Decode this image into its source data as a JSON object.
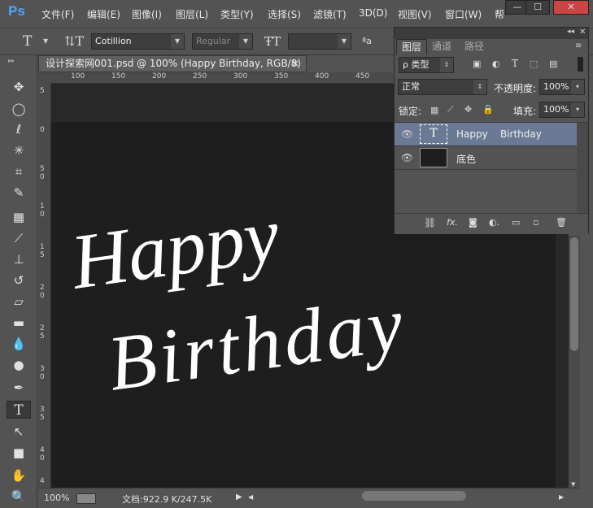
{
  "app": {
    "logo": "Ps"
  },
  "menu": [
    "文件(F)",
    "编辑(E)",
    "图像(I)",
    "图层(L)",
    "类型(Y)",
    "选择(S)",
    "滤镜(T)",
    "3D(D)",
    "视图(V)",
    "窗口(W)",
    "帮"
  ],
  "window_controls": {
    "minimize": "—",
    "maximize": "☐",
    "close": "✕"
  },
  "options": {
    "font_family": "Cotillion",
    "font_style": "Regular",
    "font_size": "",
    "aa_label": "ªa"
  },
  "document": {
    "tab_title": "设计探索网001.psd @ 100% (Happy    Birthday, RGB/8)",
    "tab_close": "×",
    "canvas_text_line1": "Happy",
    "canvas_text_line2": "Birthday"
  },
  "rulers": {
    "horizontal": [
      "100",
      "150",
      "200",
      "250",
      "300",
      "350",
      "400",
      "450"
    ],
    "vertical": [
      "5",
      "0",
      "5",
      "0",
      "1",
      "0",
      "1",
      "5",
      "2",
      "0",
      "2",
      "5",
      "3",
      "0",
      "3",
      "5",
      "4",
      "0",
      "4",
      "5"
    ]
  },
  "status": {
    "zoom": "100%",
    "doc_info": "文档:922.9 K/247.5K"
  },
  "layers_panel": {
    "tabs": [
      "图层",
      "通道",
      "路径"
    ],
    "filter_label": "ρ 类型",
    "blend_mode": "正常",
    "opacity_label": "不透明度:",
    "opacity_value": "100%",
    "lock_label": "锁定:",
    "fill_label": "填充:",
    "fill_value": "100%",
    "layers": [
      {
        "name": "Happy    Birthday",
        "type": "text",
        "selected": true
      },
      {
        "name": "底色",
        "type": "fill",
        "selected": false
      }
    ],
    "footer_icons": [
      "link-icon",
      "fx-icon",
      "mask-icon",
      "adjustment-icon",
      "group-icon",
      "new-layer-icon",
      "trash-icon"
    ]
  },
  "colors": {
    "accent": "#4da6ff",
    "selected_layer": "#6a7a94",
    "canvas": "#1e1e1e"
  }
}
